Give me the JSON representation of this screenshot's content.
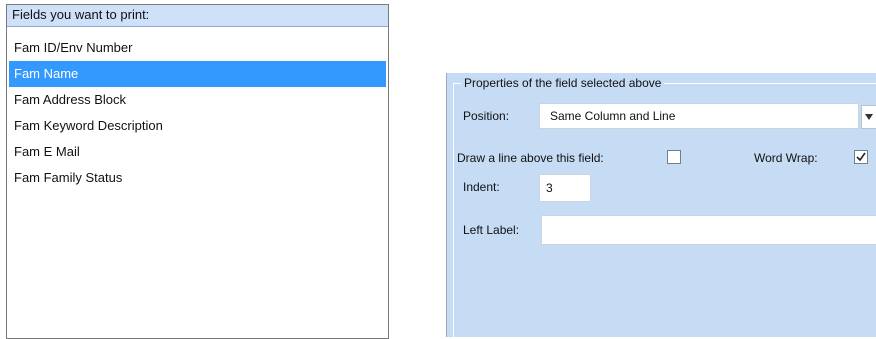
{
  "fields_list": {
    "header": "Fields you want to print:",
    "items": [
      {
        "label": "Fam ID/Env Number",
        "selected": false
      },
      {
        "label": "Fam Name",
        "selected": true
      },
      {
        "label": "Fam Address Block",
        "selected": false
      },
      {
        "label": "Fam Keyword Description",
        "selected": false
      },
      {
        "label": "Fam E Mail",
        "selected": false
      },
      {
        "label": "Fam Family Status",
        "selected": false
      }
    ]
  },
  "properties": {
    "group_title": "Properties of the field selected above",
    "position_label": "Position:",
    "position_value": "Same Column and Line",
    "draw_line_label": "Draw a line above this field:",
    "draw_line_checked": false,
    "word_wrap_label": "Word Wrap:",
    "word_wrap_checked": true,
    "indent_label": "Indent:",
    "indent_value": "3",
    "left_label_label": "Left Label:",
    "left_label_value": ""
  },
  "colors": {
    "selection": "#3399ff",
    "panel_background": "#c6dbf4",
    "header_background": "#cfe1f9"
  },
  "icons": {
    "select_arrow": "chevron-down-icon",
    "checkmark": "checkmark-icon"
  }
}
